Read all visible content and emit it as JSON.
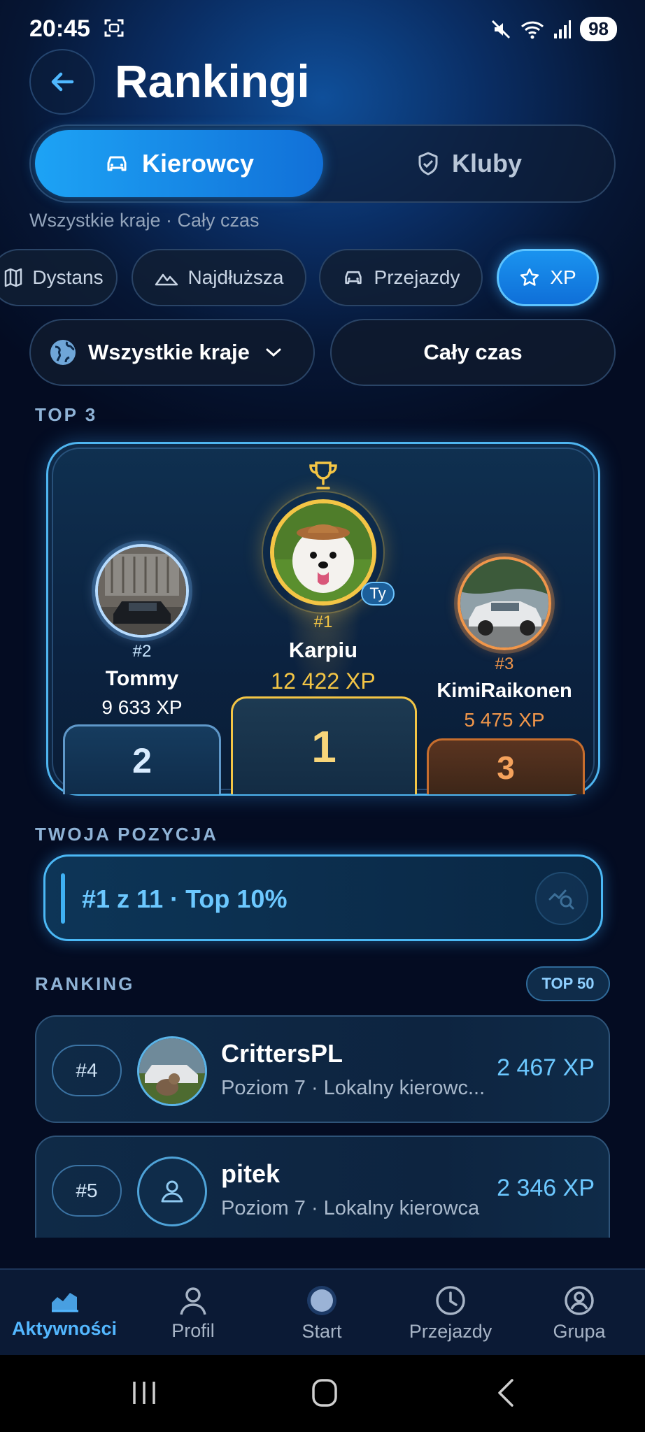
{
  "status_bar": {
    "time": "20:45",
    "battery": "98"
  },
  "header": {
    "title": "Rankingi"
  },
  "segments": [
    {
      "label": "Kierowcy",
      "active": true
    },
    {
      "label": "Kluby",
      "active": false
    }
  ],
  "filter_summary": "Wszystkie kraje · Cały czas",
  "chips": [
    {
      "label": "Dystans",
      "icon": "map-icon",
      "active": false
    },
    {
      "label": "Najdłuższa",
      "icon": "mountain-icon",
      "active": false
    },
    {
      "label": "Przejazdy",
      "icon": "car-icon",
      "active": false
    },
    {
      "label": "XP",
      "icon": "star-icon",
      "active": true
    }
  ],
  "dropdowns": {
    "country": "Wszystkie kraje",
    "period": "Cały czas"
  },
  "top3": {
    "section_label": "TOP 3",
    "first": {
      "rank": "#1",
      "name": "Karpiu",
      "xp": "12 422 XP",
      "you_badge": "Ty",
      "block": "1"
    },
    "second": {
      "rank": "#2",
      "name": "Tommy",
      "xp": "9 633 XP",
      "block": "2"
    },
    "third": {
      "rank": "#3",
      "name": "KimiRaikonen",
      "xp": "5 475 XP",
      "block": "3"
    }
  },
  "my_position": {
    "section_label": "TWOJA POZYCJA",
    "text": "#1 z 11 · Top 10%"
  },
  "ranking": {
    "section_label": "RANKING",
    "badge": "TOP 50",
    "rows": [
      {
        "rank": "#4",
        "name": "CrittersPL",
        "subtitle": "Poziom 7 · Lokalny kierowc...",
        "xp": "2 467 XP"
      },
      {
        "rank": "#5",
        "name": "pitek",
        "subtitle": "Poziom 7 · Lokalny kierowca",
        "xp": "2 346 XP"
      }
    ]
  },
  "nav": [
    {
      "label": "Aktywności",
      "icon": "chart-icon",
      "active": true
    },
    {
      "label": "Profil",
      "icon": "person-icon",
      "active": false
    },
    {
      "label": "Start",
      "icon": "start-dot-icon",
      "active": false
    },
    {
      "label": "Przejazdy",
      "icon": "clock-icon",
      "active": false
    },
    {
      "label": "Grupa",
      "icon": "group-icon",
      "active": false
    }
  ],
  "colors": {
    "accent": "#1da3f5",
    "gold": "#f3c545",
    "bronze": "#f0964a",
    "silver": "#c9e6ff"
  }
}
